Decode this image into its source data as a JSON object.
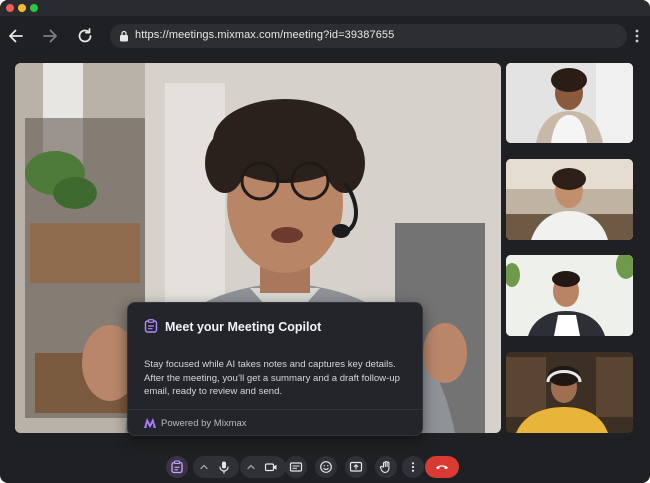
{
  "browser": {
    "url": "https://meetings.mixmax.com/meeting?id=39387655",
    "back_icon": "arrow-left-icon",
    "forward_icon": "arrow-right-icon",
    "reload_icon": "reload-icon",
    "menu_icon": "kebab-menu-icon"
  },
  "copilot": {
    "title": "Meet your Meeting Copilot",
    "body": "Stay focused while AI takes notes and captures key details. After the meeting, you’ll get a summary and a draft follow-up email, ready to review and send.",
    "footer": "Powered by Mixmax",
    "icon": "copilot-clipboard-icon",
    "accent": "#b58cff"
  },
  "participants": {
    "main": "speaker-video",
    "thumbnails": [
      "participant-1",
      "participant-2",
      "participant-3",
      "participant-4"
    ]
  },
  "controls": [
    {
      "name": "copilot-toggle",
      "icon": "clipboard-icon",
      "active": true
    },
    {
      "name": "microphone",
      "icon": "microphone-icon"
    },
    {
      "name": "camera",
      "icon": "camera-icon"
    },
    {
      "name": "captions",
      "icon": "captions-icon"
    },
    {
      "name": "reactions",
      "icon": "emoji-icon"
    },
    {
      "name": "present",
      "icon": "present-screen-icon"
    },
    {
      "name": "raise-hand",
      "icon": "hand-icon"
    },
    {
      "name": "more",
      "icon": "more-vertical-icon"
    },
    {
      "name": "end-call",
      "icon": "phone-hangup-icon",
      "color": "#d93a34"
    }
  ]
}
